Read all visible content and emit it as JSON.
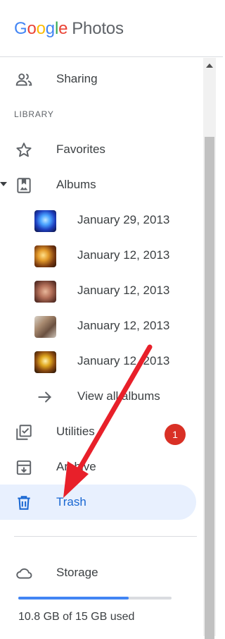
{
  "app": {
    "logo_google": [
      "G",
      "o",
      "o",
      "g",
      "l",
      "e"
    ],
    "logo_product": "Photos"
  },
  "nav": {
    "sharing": "Sharing",
    "library_header": "LIBRARY",
    "favorites": "Favorites",
    "albums": "Albums",
    "album_items": [
      {
        "label": "January 29, 2013"
      },
      {
        "label": "January 12, 2013"
      },
      {
        "label": "January 12, 2013"
      },
      {
        "label": "January 12, 2013"
      },
      {
        "label": "January 12, 2013"
      }
    ],
    "view_all": "View all albums",
    "utilities": "Utilities",
    "utilities_badge": "1",
    "archive": "Archive",
    "trash": "Trash",
    "storage": "Storage",
    "storage_used_text": "10.8 GB of 15 GB used",
    "storage_fraction": 0.72
  },
  "colors": {
    "accent": "#1967d2",
    "selected_bg": "#e8f0fe",
    "badge": "#d93025",
    "annotation_arrow": "#e8202a"
  },
  "icons": {
    "sharing": "people-icon",
    "favorites": "star-icon",
    "albums": "album-icon",
    "view_all": "arrow-right-icon",
    "utilities": "checklist-icon",
    "archive": "archive-icon",
    "trash": "trash-icon",
    "storage": "cloud-icon"
  }
}
